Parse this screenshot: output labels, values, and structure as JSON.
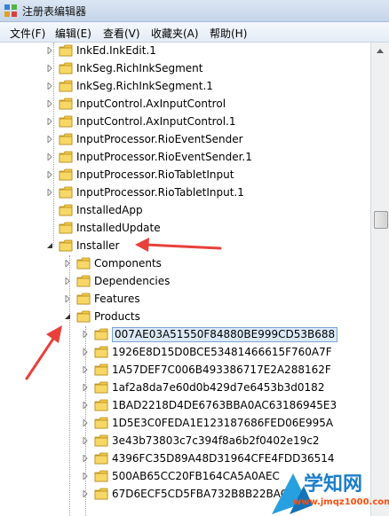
{
  "window": {
    "title": "注册表编辑器"
  },
  "menu": [
    {
      "label": "文件(F)"
    },
    {
      "label": "编辑(E)"
    },
    {
      "label": "查看(V)"
    },
    {
      "label": "收藏夹(A)"
    },
    {
      "label": "帮助(H)"
    }
  ],
  "tree": {
    "rows": [
      {
        "label": "InkEd.InkEdit.1",
        "level": 1,
        "expander": "collapsed"
      },
      {
        "label": "InkSeg.RichInkSegment",
        "level": 1,
        "expander": "collapsed"
      },
      {
        "label": "InkSeg.RichInkSegment.1",
        "level": 1,
        "expander": "collapsed"
      },
      {
        "label": "InputControl.AxInputControl",
        "level": 1,
        "expander": "collapsed"
      },
      {
        "label": "InputControl.AxInputControl.1",
        "level": 1,
        "expander": "collapsed"
      },
      {
        "label": "InputProcessor.RioEventSender",
        "level": 1,
        "expander": "collapsed"
      },
      {
        "label": "InputProcessor.RioEventSender.1",
        "level": 1,
        "expander": "collapsed"
      },
      {
        "label": "InputProcessor.RioTabletInput",
        "level": 1,
        "expander": "collapsed"
      },
      {
        "label": "InputProcessor.RioTabletInput.1",
        "level": 1,
        "expander": "collapsed"
      },
      {
        "label": "InstalledApp",
        "level": 1,
        "expander": "none"
      },
      {
        "label": "InstalledUpdate",
        "level": 1,
        "expander": "none"
      },
      {
        "label": "Installer",
        "level": 1,
        "expander": "expanded"
      },
      {
        "label": "Components",
        "level": 2,
        "expander": "collapsed"
      },
      {
        "label": "Dependencies",
        "level": 2,
        "expander": "collapsed"
      },
      {
        "label": "Features",
        "level": 2,
        "expander": "collapsed"
      },
      {
        "label": "Products",
        "level": 2,
        "expander": "expanded"
      },
      {
        "label": "007AE03A51550F84880BE999CD53B688",
        "level": 3,
        "expander": "collapsed",
        "selected": true
      },
      {
        "label": "1926E8D15D0BCE53481466615F760A7F",
        "level": 3,
        "expander": "collapsed"
      },
      {
        "label": "1A57DEF7C006B493386717E2A288162F",
        "level": 3,
        "expander": "collapsed"
      },
      {
        "label": "1af2a8da7e60d0b429d7e6453b3d0182",
        "level": 3,
        "expander": "collapsed"
      },
      {
        "label": "1BAD2218D4DE6763BBA0AC63186945E3",
        "level": 3,
        "expander": "collapsed"
      },
      {
        "label": "1D5E3C0FEDA1E123187686FED06E995A",
        "level": 3,
        "expander": "collapsed"
      },
      {
        "label": "3e43b73803c7c394f8a6b2f0402e19c2",
        "level": 3,
        "expander": "collapsed"
      },
      {
        "label": "4396FC35D89A48D31964CFE4FDD36514",
        "level": 3,
        "expander": "collapsed"
      },
      {
        "label": "500AB65CC20FB164CA5A0AEC",
        "level": 3,
        "expander": "collapsed"
      },
      {
        "label": "67D6ECF5CD5FBA732B8B22BAC",
        "level": 3,
        "expander": "collapsed"
      }
    ]
  },
  "watermark": {
    "text": "学知网",
    "url": "www.jmqz1000.com"
  },
  "colors": {
    "folder": "#f0c94a",
    "annotation_arrow": "#e8403a",
    "selection": "#dceaf8"
  }
}
